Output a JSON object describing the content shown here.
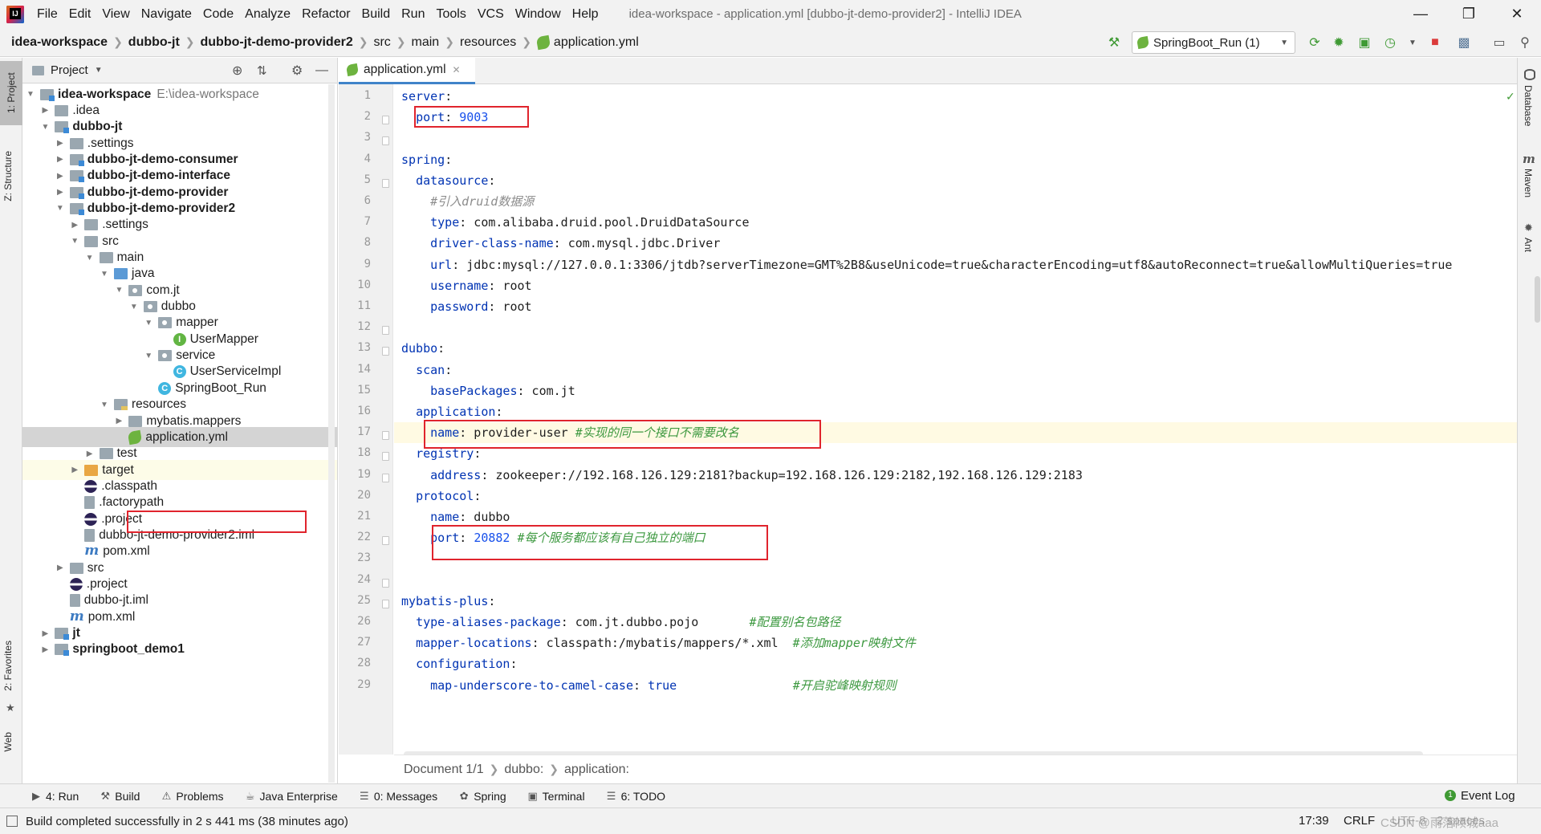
{
  "menubar": {
    "items": [
      "File",
      "Edit",
      "View",
      "Navigate",
      "Code",
      "Analyze",
      "Refactor",
      "Build",
      "Run",
      "Tools",
      "VCS",
      "Window",
      "Help"
    ],
    "window_title": "idea-workspace - application.yml [dubbo-jt-demo-provider2] - IntelliJ IDEA"
  },
  "navbar": {
    "crumbs": [
      "idea-workspace",
      "dubbo-jt",
      "dubbo-jt-demo-provider2",
      "src",
      "main",
      "resources",
      "application.yml"
    ],
    "run_config": "SpringBoot_Run (1)"
  },
  "left_strip": {
    "project_tab": "1: Project",
    "structure_tab": "Z: Structure",
    "favorites_tab": "2: Favorites",
    "web_tab": "Web"
  },
  "right_strip": {
    "database_tab": "Database",
    "maven_tab": "Maven",
    "ant_tab": "Ant"
  },
  "project_panel": {
    "title": "Project",
    "tree": [
      {
        "label": "idea-workspace",
        "extra": "E:\\idea-workspace",
        "bold": true,
        "depth": 0,
        "arrow": "down",
        "icon": "folder-module"
      },
      {
        "label": ".idea",
        "depth": 1,
        "arrow": "right",
        "icon": "folder"
      },
      {
        "label": "dubbo-jt",
        "bold": true,
        "depth": 1,
        "arrow": "down",
        "icon": "folder-module"
      },
      {
        "label": ".settings",
        "depth": 2,
        "arrow": "right",
        "icon": "folder"
      },
      {
        "label": "dubbo-jt-demo-consumer",
        "bold": true,
        "depth": 2,
        "arrow": "right",
        "icon": "folder-module"
      },
      {
        "label": "dubbo-jt-demo-interface",
        "bold": true,
        "depth": 2,
        "arrow": "right",
        "icon": "folder-module"
      },
      {
        "label": "dubbo-jt-demo-provider",
        "bold": true,
        "depth": 2,
        "arrow": "right",
        "icon": "folder-module"
      },
      {
        "label": "dubbo-jt-demo-provider2",
        "bold": true,
        "depth": 2,
        "arrow": "down",
        "icon": "folder-module"
      },
      {
        "label": ".settings",
        "depth": 3,
        "arrow": "right",
        "icon": "folder"
      },
      {
        "label": "src",
        "depth": 3,
        "arrow": "down",
        "icon": "folder"
      },
      {
        "label": "main",
        "depth": 4,
        "arrow": "down",
        "icon": "folder"
      },
      {
        "label": "java",
        "depth": 5,
        "arrow": "down",
        "icon": "folder-src"
      },
      {
        "label": "com.jt",
        "depth": 6,
        "arrow": "down",
        "icon": "folder-pkg"
      },
      {
        "label": "dubbo",
        "depth": 7,
        "arrow": "down",
        "icon": "folder-pkg"
      },
      {
        "label": "mapper",
        "depth": 8,
        "arrow": "down",
        "icon": "folder-pkg"
      },
      {
        "label": "UserMapper",
        "depth": 9,
        "arrow": "none",
        "icon": "interface"
      },
      {
        "label": "service",
        "depth": 8,
        "arrow": "down",
        "icon": "folder-pkg"
      },
      {
        "label": "UserServiceImpl",
        "depth": 9,
        "arrow": "none",
        "icon": "class"
      },
      {
        "label": "SpringBoot_Run",
        "depth": 8,
        "arrow": "none",
        "icon": "class-run"
      },
      {
        "label": "resources",
        "depth": 5,
        "arrow": "down",
        "icon": "folder-res"
      },
      {
        "label": "mybatis.mappers",
        "depth": 6,
        "arrow": "right",
        "icon": "folder"
      },
      {
        "label": "application.yml",
        "depth": 6,
        "arrow": "none",
        "icon": "yml",
        "selected": true
      },
      {
        "label": "test",
        "depth": 4,
        "arrow": "right",
        "icon": "folder"
      },
      {
        "label": "target",
        "depth": 3,
        "arrow": "right",
        "icon": "folder-orange",
        "highlight": true
      },
      {
        "label": ".classpath",
        "depth": 3,
        "arrow": "none",
        "icon": "eclipse"
      },
      {
        "label": ".factorypath",
        "depth": 3,
        "arrow": "none",
        "icon": "file"
      },
      {
        "label": ".project",
        "depth": 3,
        "arrow": "none",
        "icon": "eclipse"
      },
      {
        "label": "dubbo-jt-demo-provider2.iml",
        "depth": 3,
        "arrow": "none",
        "icon": "file"
      },
      {
        "label": "pom.xml",
        "depth": 3,
        "arrow": "none",
        "icon": "maven"
      },
      {
        "label": "src",
        "depth": 2,
        "arrow": "right",
        "icon": "folder"
      },
      {
        "label": ".project",
        "depth": 2,
        "arrow": "none",
        "icon": "eclipse"
      },
      {
        "label": "dubbo-jt.iml",
        "depth": 2,
        "arrow": "none",
        "icon": "file"
      },
      {
        "label": "pom.xml",
        "depth": 2,
        "arrow": "none",
        "icon": "maven"
      },
      {
        "label": "jt",
        "bold": true,
        "depth": 1,
        "arrow": "right",
        "icon": "folder-module"
      },
      {
        "label": "springboot_demo1",
        "bold": true,
        "depth": 1,
        "arrow": "right",
        "icon": "folder-module"
      }
    ]
  },
  "editor": {
    "tab_label": "application.yml",
    "current_line": 17,
    "lines": [
      [
        [
          "k",
          "server"
        ],
        [
          "t",
          ":"
        ]
      ],
      [
        [
          "t",
          "  "
        ],
        [
          "k",
          "port"
        ],
        [
          "t",
          ": "
        ],
        [
          "n",
          "9003"
        ]
      ],
      [],
      [
        [
          "k",
          "spring"
        ],
        [
          "t",
          ":"
        ]
      ],
      [
        [
          "t",
          "  "
        ],
        [
          "k",
          "datasource"
        ],
        [
          "t",
          ":"
        ]
      ],
      [
        [
          "t",
          "    "
        ],
        [
          "c",
          "#引入druid数据源"
        ]
      ],
      [
        [
          "t",
          "    "
        ],
        [
          "k",
          "type"
        ],
        [
          "t",
          ": com.alibaba.druid.pool.DruidDataSource"
        ]
      ],
      [
        [
          "t",
          "    "
        ],
        [
          "k",
          "driver-class-name"
        ],
        [
          "t",
          ": com.mysql.jdbc.Driver"
        ]
      ],
      [
        [
          "t",
          "    "
        ],
        [
          "k",
          "url"
        ],
        [
          "t",
          ": jdbc:mysql://127.0.0.1:3306/jtdb?serverTimezone=GMT%2B8&useUnicode=true&characterEncoding=utf8&autoReconnect=true&allowMultiQueries=true"
        ]
      ],
      [
        [
          "t",
          "    "
        ],
        [
          "k",
          "username"
        ],
        [
          "t",
          ": root"
        ]
      ],
      [
        [
          "t",
          "    "
        ],
        [
          "k",
          "password"
        ],
        [
          "t",
          ": root"
        ]
      ],
      [],
      [
        [
          "k",
          "dubbo"
        ],
        [
          "t",
          ":"
        ]
      ],
      [
        [
          "t",
          "  "
        ],
        [
          "k",
          "scan"
        ],
        [
          "t",
          ":"
        ]
      ],
      [
        [
          "t",
          "    "
        ],
        [
          "k",
          "basePackages"
        ],
        [
          "t",
          ": com.jt"
        ]
      ],
      [
        [
          "t",
          "  "
        ],
        [
          "k",
          "application"
        ],
        [
          "t",
          ":"
        ]
      ],
      [
        [
          "t",
          "    "
        ],
        [
          "k",
          "name"
        ],
        [
          "t",
          ": provider-user "
        ],
        [
          "cg",
          "#实现的同一个接口不需要改名"
        ]
      ],
      [
        [
          "t",
          "  "
        ],
        [
          "k",
          "registry"
        ],
        [
          "t",
          ":"
        ]
      ],
      [
        [
          "t",
          "    "
        ],
        [
          "k",
          "address"
        ],
        [
          "t",
          ": zookeeper://192.168.126.129:2181?backup=192.168.126.129:2182,192.168.126.129:2183"
        ]
      ],
      [
        [
          "t",
          "  "
        ],
        [
          "k",
          "protocol"
        ],
        [
          "t",
          ":"
        ]
      ],
      [
        [
          "t",
          "    "
        ],
        [
          "k",
          "name"
        ],
        [
          "t",
          ": dubbo"
        ]
      ],
      [
        [
          "t",
          "    "
        ],
        [
          "k",
          "port"
        ],
        [
          "t",
          ": "
        ],
        [
          "n",
          "20882"
        ],
        [
          "t",
          " "
        ],
        [
          "cg",
          "#每个服务都应该有自己独立的端口"
        ]
      ],
      [],
      [],
      [
        [
          "k",
          "mybatis-plus"
        ],
        [
          "t",
          ":"
        ]
      ],
      [
        [
          "t",
          "  "
        ],
        [
          "k",
          "type-aliases-package"
        ],
        [
          "t",
          ": com.jt.dubbo.pojo       "
        ],
        [
          "cg",
          "#配置别名包路径"
        ]
      ],
      [
        [
          "t",
          "  "
        ],
        [
          "k",
          "mapper-locations"
        ],
        [
          "t",
          ": classpath:/mybatis/mappers/*.xml  "
        ],
        [
          "cg",
          "#添加mapper映射文件"
        ]
      ],
      [
        [
          "t",
          "  "
        ],
        [
          "k",
          "configuration"
        ],
        [
          "t",
          ":"
        ]
      ],
      [
        [
          "t",
          "    "
        ],
        [
          "k",
          "map-underscore-to-camel-case"
        ],
        [
          "t",
          ": "
        ],
        [
          "k",
          "true"
        ],
        [
          "t",
          "                "
        ],
        [
          "cg",
          "#开启驼峰映射规则"
        ]
      ]
    ],
    "breadcrumb": [
      "Document 1/1",
      "dubbo:",
      "application:"
    ]
  },
  "bottom_tools": [
    {
      "label": "4: Run",
      "icon": "run-icon"
    },
    {
      "label": "Build",
      "icon": "hammer-icon"
    },
    {
      "label": "Problems",
      "icon": "warning-icon"
    },
    {
      "label": "Java Enterprise",
      "icon": "java-ee-icon"
    },
    {
      "label": "0: Messages",
      "icon": "messages-icon"
    },
    {
      "label": "Spring",
      "icon": "spring-icon"
    },
    {
      "label": "Terminal",
      "icon": "terminal-icon"
    },
    {
      "label": "6: TODO",
      "icon": "todo-icon"
    }
  ],
  "event_log": "Event Log",
  "status": {
    "message": "Build completed successfully in 2 s 441 ms (38 minutes ago)",
    "position": "17:39",
    "line_sep": "CRLF",
    "encoding": "UTF-8",
    "indent": "2 spaces",
    "watermark": "CSDN @雨落倾城aaa"
  },
  "colors": {
    "accent": "#4083c9",
    "annotation_box": "#e0242d",
    "key": "#0033b3",
    "number": "#1750eb",
    "comment": "#3d9940"
  }
}
